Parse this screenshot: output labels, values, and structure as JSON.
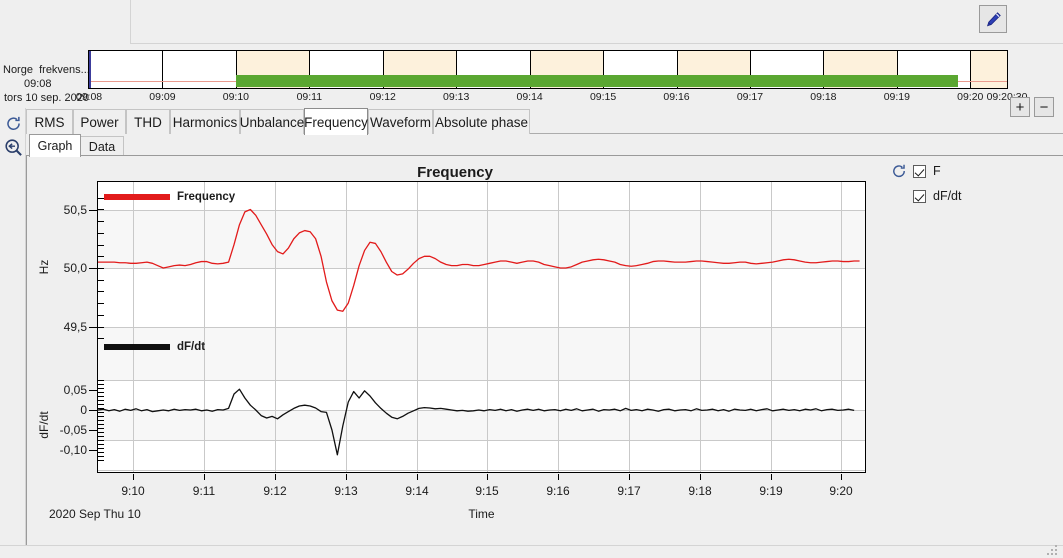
{
  "window": {
    "edit_button": "pencil-edit"
  },
  "timeline": {
    "site_name": "Norge",
    "measurement": "frekvens...",
    "start_time": "09:08",
    "date_line": "tors 10 sep. 2020",
    "axis_labels": [
      "09:08",
      "09:09",
      "09:10",
      "09:11",
      "09:12",
      "09:13",
      "09:14",
      "09:15",
      "09:16",
      "09:17",
      "09:18",
      "09:19",
      "09:20",
      "09:20:30"
    ],
    "zoom_in": "+",
    "zoom_out": "−",
    "colors": {
      "cream": "#fdf1dc",
      "green": "#5aa731",
      "pink": "#ea9a8e"
    }
  },
  "main_tabs": [
    {
      "label": "RMS",
      "active": false
    },
    {
      "label": "Power",
      "active": false
    },
    {
      "label": "THD",
      "active": false
    },
    {
      "label": "Harmonics",
      "active": false
    },
    {
      "label": "Unbalance",
      "active": false
    },
    {
      "label": "Frequency",
      "active": true
    },
    {
      "label": "Waveform",
      "active": false
    },
    {
      "label": "Absolute phase",
      "active": false
    }
  ],
  "sub_tabs": [
    {
      "label": "Graph",
      "active": true
    },
    {
      "label": "Data",
      "active": false
    }
  ],
  "rail": {
    "refresh": "refresh-icon",
    "zoom_back": "zoom-back-icon"
  },
  "right_panel": {
    "refresh": "refresh-icon",
    "series": [
      {
        "label": "F",
        "checked": true
      },
      {
        "label": "dF/dt",
        "checked": true
      }
    ]
  },
  "chart_data": {
    "type": "line",
    "title": "Frequency",
    "xlabel": "Time",
    "date_label": "2020 Sep Thu 10",
    "x_ticks": [
      "9:10",
      "9:11",
      "9:12",
      "9:13",
      "9:14",
      "9:15",
      "9:16",
      "9:17",
      "9:18",
      "9:19",
      "9:20"
    ],
    "xlim": [
      "9:09:30",
      "9:20:20"
    ],
    "grid": true,
    "legend_position": "inside-top-left",
    "panels": [
      {
        "name": "F",
        "ylabel": "Hz",
        "legend": "Frequency",
        "color": "#e21b1b",
        "ylim": [
          49.35,
          50.65
        ],
        "y_ticks": [
          "50,5",
          "50,0",
          "49,5"
        ],
        "y_tick_values": [
          50.5,
          50.0,
          49.5
        ],
        "x": [
          9.1583,
          9.1667,
          9.175,
          9.1833,
          9.1917,
          9.2,
          9.2083,
          9.2167,
          9.225,
          9.2333,
          9.2417,
          9.25,
          9.2583,
          9.2667,
          9.275,
          9.2833,
          9.2917,
          9.3,
          9.3083,
          9.3167,
          9.325,
          9.3333,
          9.3417,
          9.35,
          9.3583,
          9.3667,
          9.375,
          9.3833,
          9.3917,
          9.4,
          9.4083,
          9.4167,
          9.425,
          9.4333,
          9.4417,
          9.45,
          9.4583,
          9.4667,
          9.475,
          9.4833,
          9.4917,
          9.5,
          9.5083,
          9.5167,
          9.525,
          9.5333,
          9.5417,
          9.55,
          9.5583,
          9.5667,
          9.575,
          9.5833,
          9.5917,
          9.6,
          9.6083,
          9.6167,
          9.625,
          9.6333,
          9.6417,
          9.65,
          9.6583,
          9.6667,
          9.675,
          9.6833,
          9.6917,
          9.7,
          9.7083,
          9.7167,
          9.725,
          9.7333,
          9.7417,
          9.75,
          9.7583,
          9.7667,
          9.775,
          9.7833,
          9.7917,
          9.8,
          9.8083,
          9.8167,
          9.825,
          9.8333,
          9.8417,
          9.85,
          9.8583,
          9.8667,
          9.875,
          9.8833,
          9.8917,
          9.9,
          9.9083,
          9.9167,
          9.925,
          9.9333,
          9.9417,
          9.95,
          9.9583,
          9.9667,
          9.975,
          9.9833,
          9.9917,
          10.0,
          10.0083,
          10.0167,
          10.025,
          10.0333,
          10.0417,
          10.05,
          10.0583,
          10.0667,
          10.075,
          10.0833,
          10.0917,
          10.1,
          10.1083,
          10.1167,
          10.125,
          10.1333,
          10.1417,
          10.15,
          10.1583,
          10.1667,
          10.175,
          10.1833,
          10.1917,
          10.2,
          10.2083,
          10.2167,
          10.225,
          10.2333,
          10.2417,
          10.25,
          10.2583,
          10.2667,
          10.275,
          10.2833,
          10.2917,
          10.3,
          10.3083,
          10.3167,
          10.325,
          10.3333
        ],
        "y": [
          50.05,
          50.05,
          50.05,
          50.05,
          50.045,
          50.045,
          50.04,
          50.04,
          50.045,
          50.05,
          50.04,
          50.02,
          50.0,
          50.01,
          50.02,
          50.025,
          50.02,
          50.03,
          50.045,
          50.055,
          50.055,
          50.04,
          50.035,
          50.04,
          50.05,
          50.2,
          50.37,
          50.48,
          50.5,
          50.45,
          50.37,
          50.29,
          50.2,
          50.14,
          50.12,
          50.17,
          50.25,
          50.3,
          50.32,
          50.31,
          50.25,
          50.1,
          49.88,
          49.72,
          49.64,
          49.63,
          49.7,
          49.85,
          50.02,
          50.15,
          50.22,
          50.21,
          50.14,
          50.05,
          49.97,
          49.94,
          49.95,
          49.99,
          50.04,
          50.08,
          50.1,
          50.1,
          50.08,
          50.05,
          50.03,
          50.02,
          50.02,
          50.03,
          50.03,
          50.02,
          50.02,
          50.03,
          50.04,
          50.05,
          50.06,
          50.06,
          50.05,
          50.04,
          50.05,
          50.06,
          50.06,
          50.05,
          50.03,
          50.02,
          50.01,
          50.0,
          50.0,
          50.01,
          50.03,
          50.05,
          50.06,
          50.07,
          50.075,
          50.07,
          50.06,
          50.05,
          50.03,
          50.02,
          50.015,
          50.02,
          50.03,
          50.04,
          50.055,
          50.06,
          50.06,
          50.055,
          50.05,
          50.05,
          50.05,
          50.055,
          50.06,
          50.06,
          50.055,
          50.05,
          50.045,
          50.04,
          50.04,
          50.045,
          50.05,
          50.05,
          50.04,
          50.035,
          50.04,
          50.045,
          50.05,
          50.06,
          50.07,
          50.075,
          50.07,
          50.06,
          50.05,
          50.045,
          50.045,
          50.05,
          50.055,
          50.06,
          50.06,
          50.055,
          50.055,
          50.06,
          50.06
        ]
      },
      {
        "name": "dF/dt",
        "ylabel": "dF/dt",
        "legend": "dF/dt",
        "color": "#101010",
        "ylim": [
          -0.125,
          0.075
        ],
        "y_ticks": [
          "0,05",
          "0",
          "-0,05",
          "-0,10"
        ],
        "y_tick_values": [
          0.05,
          0.0,
          -0.05,
          -0.1
        ],
        "x": [
          9.1583,
          9.1667,
          9.175,
          9.1833,
          9.1917,
          9.2,
          9.2083,
          9.2167,
          9.225,
          9.2333,
          9.2417,
          9.25,
          9.2583,
          9.2667,
          9.275,
          9.2833,
          9.2917,
          9.3,
          9.3083,
          9.3167,
          9.325,
          9.3333,
          9.3417,
          9.35,
          9.3583,
          9.3667,
          9.375,
          9.3833,
          9.3917,
          9.4,
          9.4083,
          9.4167,
          9.425,
          9.4333,
          9.4417,
          9.45,
          9.4583,
          9.4667,
          9.475,
          9.4833,
          9.4917,
          9.5,
          9.5083,
          9.5167,
          9.525,
          9.5333,
          9.5417,
          9.55,
          9.5583,
          9.5667,
          9.575,
          9.5833,
          9.5917,
          9.6,
          9.6083,
          9.6167,
          9.625,
          9.6333,
          9.6417,
          9.65,
          9.6583,
          9.6667,
          9.675,
          9.6833,
          9.6917,
          9.7,
          9.7083,
          9.7167,
          9.725,
          9.7333,
          9.7417,
          9.75,
          9.7583,
          9.7667,
          9.775,
          9.7833,
          9.7917,
          9.8,
          9.8083,
          9.8167,
          9.825,
          9.8333,
          9.8417,
          9.85,
          9.8583,
          9.8667,
          9.875,
          9.8833,
          9.8917,
          9.9,
          9.9083,
          9.9167,
          9.925,
          9.9333,
          9.9417,
          9.95,
          9.9583,
          9.9667,
          9.975,
          9.9833,
          9.9917,
          10.0,
          10.0083,
          10.0167,
          10.025,
          10.0333,
          10.0417,
          10.05,
          10.0583,
          10.0667,
          10.075,
          10.0833,
          10.0917,
          10.1,
          10.1083,
          10.1167,
          10.125,
          10.1333,
          10.1417,
          10.15,
          10.1583,
          10.1667,
          10.175,
          10.1833,
          10.1917,
          10.2,
          10.2083,
          10.2167,
          10.225,
          10.2333,
          10.2417,
          10.25,
          10.2583,
          10.2667,
          10.275,
          10.2833,
          10.2917,
          10.3,
          10.3083,
          10.3167,
          10.325,
          10.3333
        ],
        "y": [
          0.0,
          0.002,
          -0.002,
          0.001,
          -0.003,
          0.002,
          -0.001,
          0.003,
          -0.002,
          0.001,
          -0.004,
          -0.002,
          0.0,
          -0.002,
          0.002,
          -0.001,
          0.001,
          0.0,
          0.002,
          -0.002,
          0.0,
          -0.003,
          0.001,
          0.0,
          0.004,
          0.04,
          0.052,
          0.03,
          0.012,
          0.0,
          -0.014,
          -0.02,
          -0.016,
          -0.022,
          -0.012,
          -0.004,
          0.004,
          0.01,
          0.012,
          0.01,
          0.005,
          -0.004,
          -0.006,
          -0.05,
          -0.112,
          -0.04,
          0.02,
          0.046,
          0.03,
          0.048,
          0.035,
          0.018,
          0.004,
          -0.008,
          -0.018,
          -0.022,
          -0.016,
          -0.008,
          -0.002,
          0.004,
          0.006,
          0.005,
          0.003,
          0.004,
          0.002,
          0.0,
          -0.002,
          -0.001,
          -0.003,
          -0.002,
          0.0,
          -0.002,
          0.001,
          -0.001,
          0.002,
          -0.002,
          0.001,
          -0.003,
          0.0,
          0.002,
          -0.001,
          0.002,
          -0.002,
          0.0,
          0.001,
          -0.002,
          0.002,
          -0.001,
          0.003,
          -0.002,
          0.0,
          0.002,
          -0.003,
          0.001,
          0.0,
          0.002,
          -0.002,
          0.004,
          -0.001,
          0.001,
          -0.002,
          0.002,
          0.0,
          -0.003,
          0.001,
          0.002,
          -0.002,
          0.0,
          0.001,
          -0.002,
          0.003,
          -0.001,
          0.0,
          0.002,
          -0.002,
          0.001,
          -0.003,
          0.002,
          0.0,
          -0.001,
          0.002,
          -0.002,
          0.001,
          0.003,
          -0.002,
          0.0,
          0.002,
          -0.001,
          0.001,
          -0.002,
          0.002,
          0.0,
          0.003,
          -0.002,
          0.001,
          0.002,
          -0.001,
          0.0,
          0.002,
          -0.001
        ]
      }
    ]
  }
}
